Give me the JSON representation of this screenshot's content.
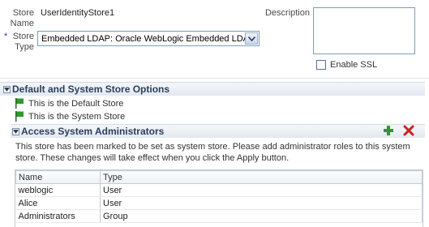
{
  "form": {
    "store_name_label": "Store\nName",
    "store_name_value": "UserIdentityStore1",
    "required_marker": "*",
    "store_type_label": "Store\nType",
    "store_type_value": "Embedded LDAP: Oracle WebLogic Embedded LDAP",
    "description_label": "Description",
    "description_value": "",
    "enable_ssl_label": "Enable SSL",
    "enable_ssl_checked": false
  },
  "default_section": {
    "title": "Default and System Store Options",
    "items": [
      "This is the Default Store",
      "This is the System Store"
    ],
    "flag_color": "#2e9a2e"
  },
  "admins_section": {
    "title": "Access System Administrators",
    "info": "This store has been marked to be set as system store. Please add administrator roles to this system store. These changes will take effect when you click the Apply button.",
    "add_icon": "plus-icon",
    "delete_icon": "x-icon",
    "columns": [
      "Name",
      "Type"
    ],
    "rows": [
      {
        "name": "weblogic",
        "type": "User"
      },
      {
        "name": "Alice",
        "type": "User"
      },
      {
        "name": "Administrators",
        "type": "Group"
      }
    ]
  },
  "colors": {
    "section_title": "#2a3e5c",
    "add_green": "#2e9a2e",
    "delete_red": "#cc2222"
  }
}
